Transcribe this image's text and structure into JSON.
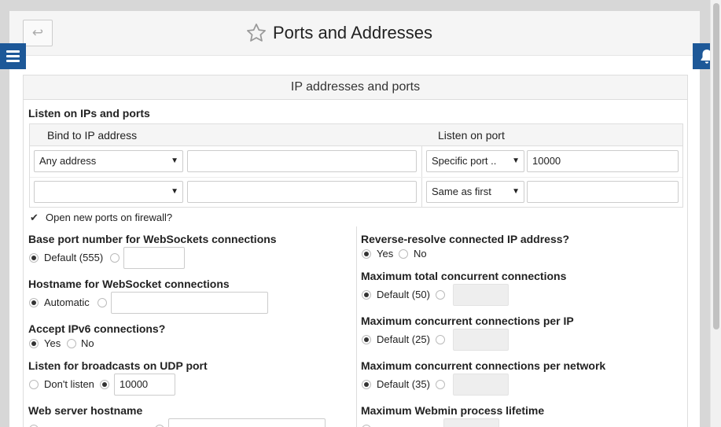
{
  "header": {
    "back_icon": "↩",
    "title": "Ports and Addresses"
  },
  "panel": {
    "title": "IP addresses and ports"
  },
  "listen": {
    "label": "Listen on IPs and ports",
    "col_ip": "Bind to IP address",
    "col_port": "Listen on port",
    "rows": [
      {
        "ip_mode": "Any address",
        "ip_value": "",
        "port_mode": "Specific port ..",
        "port_value": "10000"
      },
      {
        "ip_mode": "",
        "ip_value": "",
        "port_mode": "Same as first",
        "port_value": ""
      }
    ],
    "firewall_label": "Open new ports on firewall?",
    "firewall_checked": true
  },
  "left": {
    "websockets_port": {
      "label": "Base port number for WebSockets connections",
      "default_label": "Default (555)",
      "value": ""
    },
    "websocket_host": {
      "label": "Hostname for WebSocket connections",
      "default_label": "Automatic",
      "value": ""
    },
    "ipv6": {
      "label": "Accept IPv6 connections?",
      "yes": "Yes",
      "no": "No",
      "selected": "Yes"
    },
    "udp": {
      "label": "Listen for broadcasts on UDP port",
      "off_label": "Don't listen",
      "value": "10000"
    },
    "hostname": {
      "label": "Web server hostname"
    }
  },
  "right": {
    "reverse": {
      "label": "Reverse-resolve connected IP address?",
      "yes": "Yes",
      "no": "No",
      "selected": "Yes"
    },
    "max_total": {
      "label": "Maximum total concurrent connections",
      "default_label": "Default (50)"
    },
    "max_ip": {
      "label": "Maximum concurrent connections per IP",
      "default_label": "Default (25)"
    },
    "max_net": {
      "label": "Maximum concurrent connections per network",
      "default_label": "Default (35)"
    },
    "lifetime": {
      "label": "Maximum Webmin process lifetime"
    }
  },
  "colors": {
    "accent": "#1d5898"
  }
}
